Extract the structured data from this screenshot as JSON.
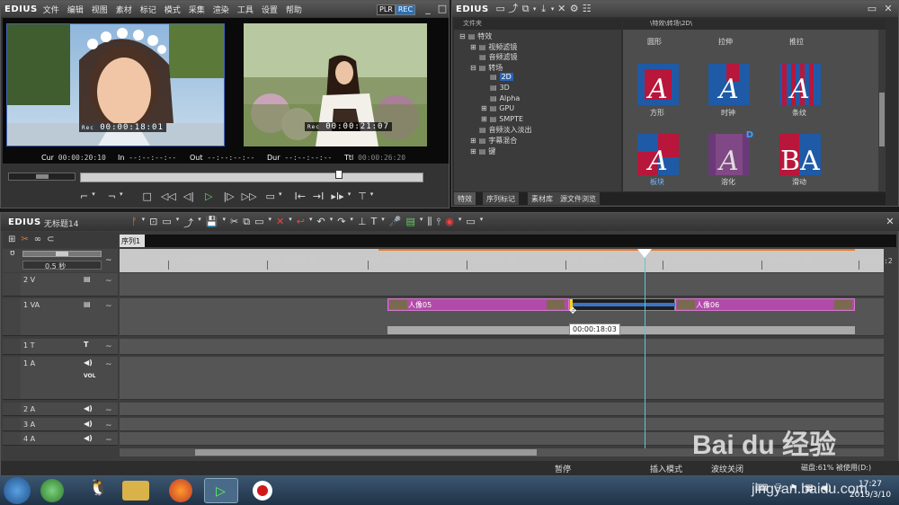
{
  "player_window": {
    "brand": "EDIUS",
    "menu": [
      "文件",
      "编辑",
      "视图",
      "素材",
      "标记",
      "模式",
      "采集",
      "渲染",
      "工具",
      "设置",
      "帮助"
    ],
    "plr_label": "PLR",
    "rec_label": "REC",
    "left_timecode_prefix": "Rec",
    "left_timecode": "00:00:18:01",
    "right_timecode_prefix": "Rec",
    "right_timecode": "00:00:21:07",
    "cur_label": "Cur",
    "cur_value": "00:00:20:10",
    "in_label": "In",
    "in_value": "--:--:--:--",
    "out_label": "Out",
    "out_value": "--:--:--:--",
    "dur_label": "Dur",
    "dur_value": "--:--:--:--",
    "ttl_label": "Ttl",
    "ttl_value": "00:00:26:20"
  },
  "effects_window": {
    "brand": "EDIUS",
    "tree_header": "文件夹",
    "tree": [
      {
        "label": "特效",
        "indent": 0,
        "expander": "-"
      },
      {
        "label": "视频滤镜",
        "indent": 1,
        "expander": "+"
      },
      {
        "label": "音频滤镜",
        "indent": 1,
        "expander": ""
      },
      {
        "label": "转场",
        "indent": 1,
        "expander": "-"
      },
      {
        "label": "2D",
        "indent": 2,
        "expander": "",
        "selected": true
      },
      {
        "label": "3D",
        "indent": 2,
        "expander": ""
      },
      {
        "label": "Alpha",
        "indent": 2,
        "expander": ""
      },
      {
        "label": "GPU",
        "indent": 2,
        "expander": "+"
      },
      {
        "label": "SMPTE",
        "indent": 2,
        "expander": "+"
      },
      {
        "label": "音频淡入淡出",
        "indent": 1,
        "expander": ""
      },
      {
        "label": "字幕混合",
        "indent": 1,
        "expander": "+"
      },
      {
        "label": "键",
        "indent": 1,
        "expander": "+"
      }
    ],
    "path": "\\特效\\转场\\2D\\",
    "top_row_labels": [
      "圆形",
      "拉伸",
      "推拉"
    ],
    "effects": [
      {
        "label": "方形",
        "icon": "square-wipe-icon"
      },
      {
        "label": "时钟",
        "icon": "clock-wipe-icon"
      },
      {
        "label": "条纹",
        "icon": "stripes-icon"
      },
      {
        "label": "板块",
        "icon": "blocks-icon",
        "highlight": true
      },
      {
        "label": "溶化",
        "icon": "dissolve-icon",
        "badge": "D"
      },
      {
        "label": "滑动",
        "icon": "slide-icon"
      }
    ],
    "tabs": [
      "特效",
      "序列标记",
      "素材库",
      "源文件浏览"
    ]
  },
  "timeline_window": {
    "brand": "EDIUS",
    "project_name": "无标题14",
    "sequence_tab": "序列1",
    "zoom_label": "0.5 秒",
    "ruler_labels": [
      "00:00:06:00",
      "00:00:09:00",
      "00:00:12:00",
      "00:00:15:00",
      "00:00:18:00",
      "00:00:21:00",
      "00:00:24:00",
      "00:00:2"
    ],
    "tracks": [
      {
        "name": "2 V",
        "type": "video"
      },
      {
        "name": "1 VA",
        "type": "video-audio"
      },
      {
        "name": "1 T",
        "type": "title"
      },
      {
        "name": "1 A",
        "type": "audio",
        "vol": "VOL"
      },
      {
        "name": "2 A",
        "type": "audio"
      },
      {
        "name": "3 A",
        "type": "audio"
      },
      {
        "name": "4 A",
        "type": "audio"
      }
    ],
    "clip_a": "人像05",
    "clip_b": "人像06",
    "tooltip": "00:00:18:03",
    "status": {
      "pause": "暂停",
      "insert_mode": "插入模式",
      "ripple": "波纹关闭",
      "disk": "磁盘:61% 被使用(D:)"
    }
  },
  "taskbar": {
    "time": "17:27",
    "date": "2019/3/10"
  },
  "watermark": {
    "logo": "Bai du 经验",
    "url": "jingyan.baidu.com"
  }
}
